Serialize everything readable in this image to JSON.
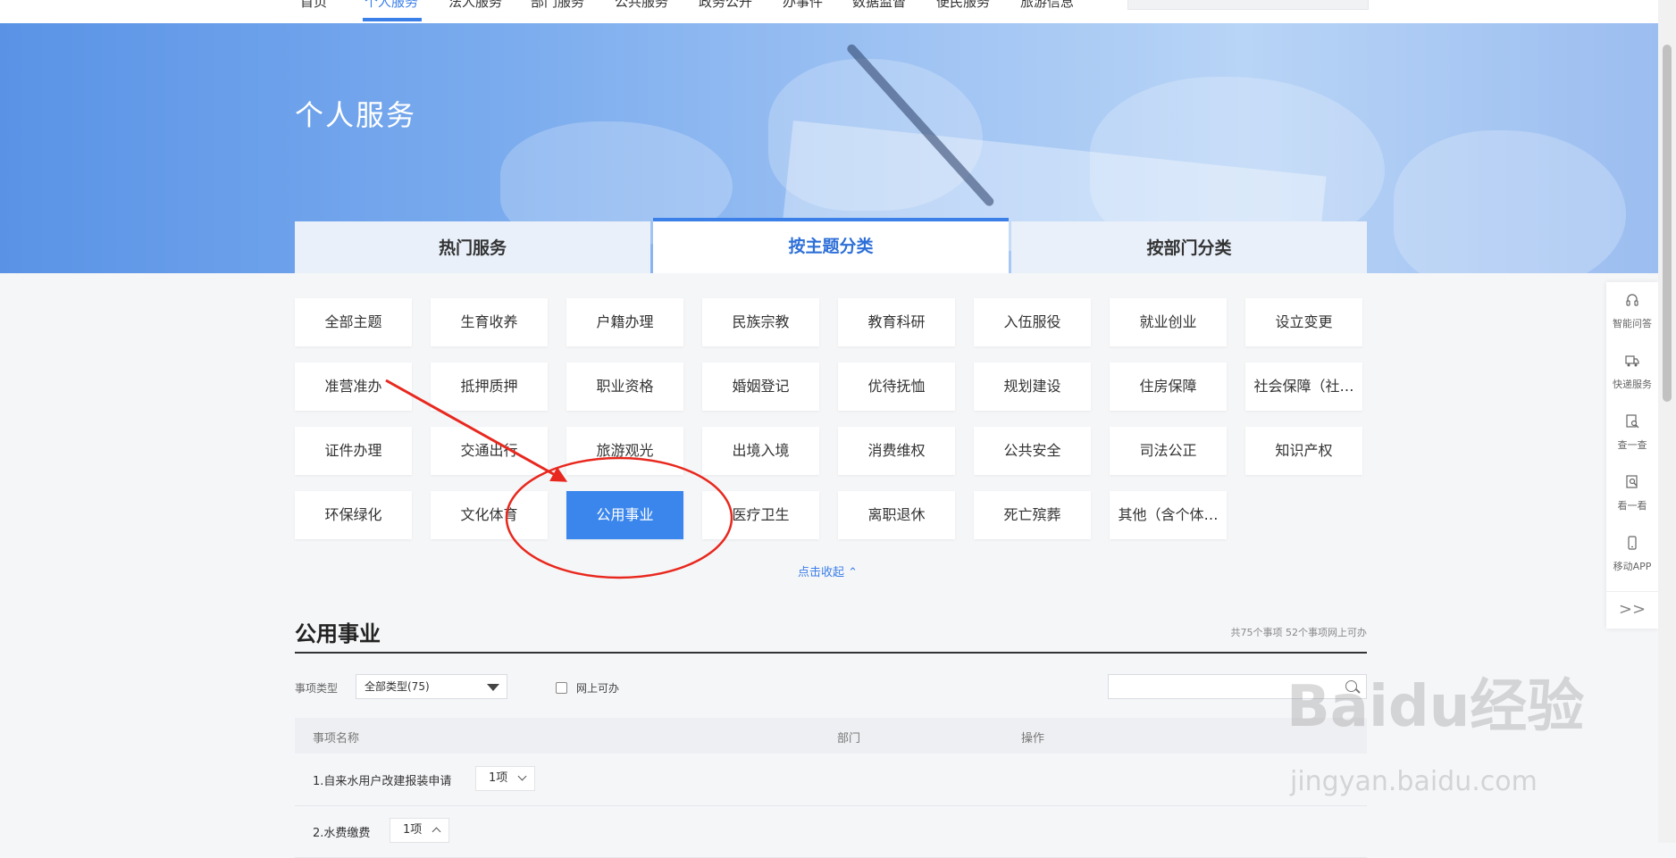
{
  "topnav": {
    "items": [
      "首页",
      "个人服务",
      "法人服务",
      "部门服务",
      "公共服务",
      "政务公开",
      "办事件",
      "数据监督",
      "便民服务",
      "旅游信息"
    ],
    "active_index": 1
  },
  "banner": {
    "title": "个人服务"
  },
  "tabs": [
    "热门服务",
    "按主题分类",
    "按部门分类"
  ],
  "active_tab": 1,
  "categories": [
    "全部主题",
    "生育收养",
    "户籍办理",
    "民族宗教",
    "教育科研",
    "入伍服役",
    "就业创业",
    "设立变更",
    "准营准办",
    "抵押质押",
    "职业资格",
    "婚姻登记",
    "优待抚恤",
    "规划建设",
    "住房保障",
    "社会保障（社…",
    "证件办理",
    "交通出行",
    "旅游观光",
    "出境入境",
    "消费维权",
    "公共安全",
    "司法公正",
    "知识产权",
    "环保绿化",
    "文化体育",
    "公用事业",
    "医疗卫生",
    "离职退休",
    "死亡殡葬",
    "其他（含个体…"
  ],
  "active_category": "公用事业",
  "collapse_label": "点击收起",
  "section": {
    "title": "公用事业",
    "count_text": "共75个事项 52个事项网上可办"
  },
  "filters": {
    "type_label": "事项类型",
    "type_value": "全部类型(75)",
    "online_label": "网上可办",
    "online_checked": false,
    "search_placeholder": ""
  },
  "table": {
    "headers": [
      "事项名称",
      "部门",
      "操作"
    ],
    "rows": [
      {
        "name": "1.自来水用户改建报装申请",
        "count": "1项",
        "expanded": false
      },
      {
        "name": "2.水费缴费",
        "count": "1项",
        "expanded": true
      }
    ]
  },
  "side_toolbar": {
    "items": [
      {
        "label": "智能问答",
        "icon": "headset-icon"
      },
      {
        "label": "快递服务",
        "icon": "truck-icon"
      },
      {
        "label": "查一查",
        "icon": "search-doc-icon"
      },
      {
        "label": "看一看",
        "icon": "view-icon"
      },
      {
        "label": "移动APP",
        "icon": "phone-icon"
      }
    ],
    "expand_label": ">>"
  },
  "watermark": {
    "text": "Baidu经验",
    "sub": "jingyan.baidu.com"
  },
  "colors": {
    "accent": "#3b7fe8",
    "active_category_bg": "#3b86ec",
    "annotation": "#e8281e"
  }
}
